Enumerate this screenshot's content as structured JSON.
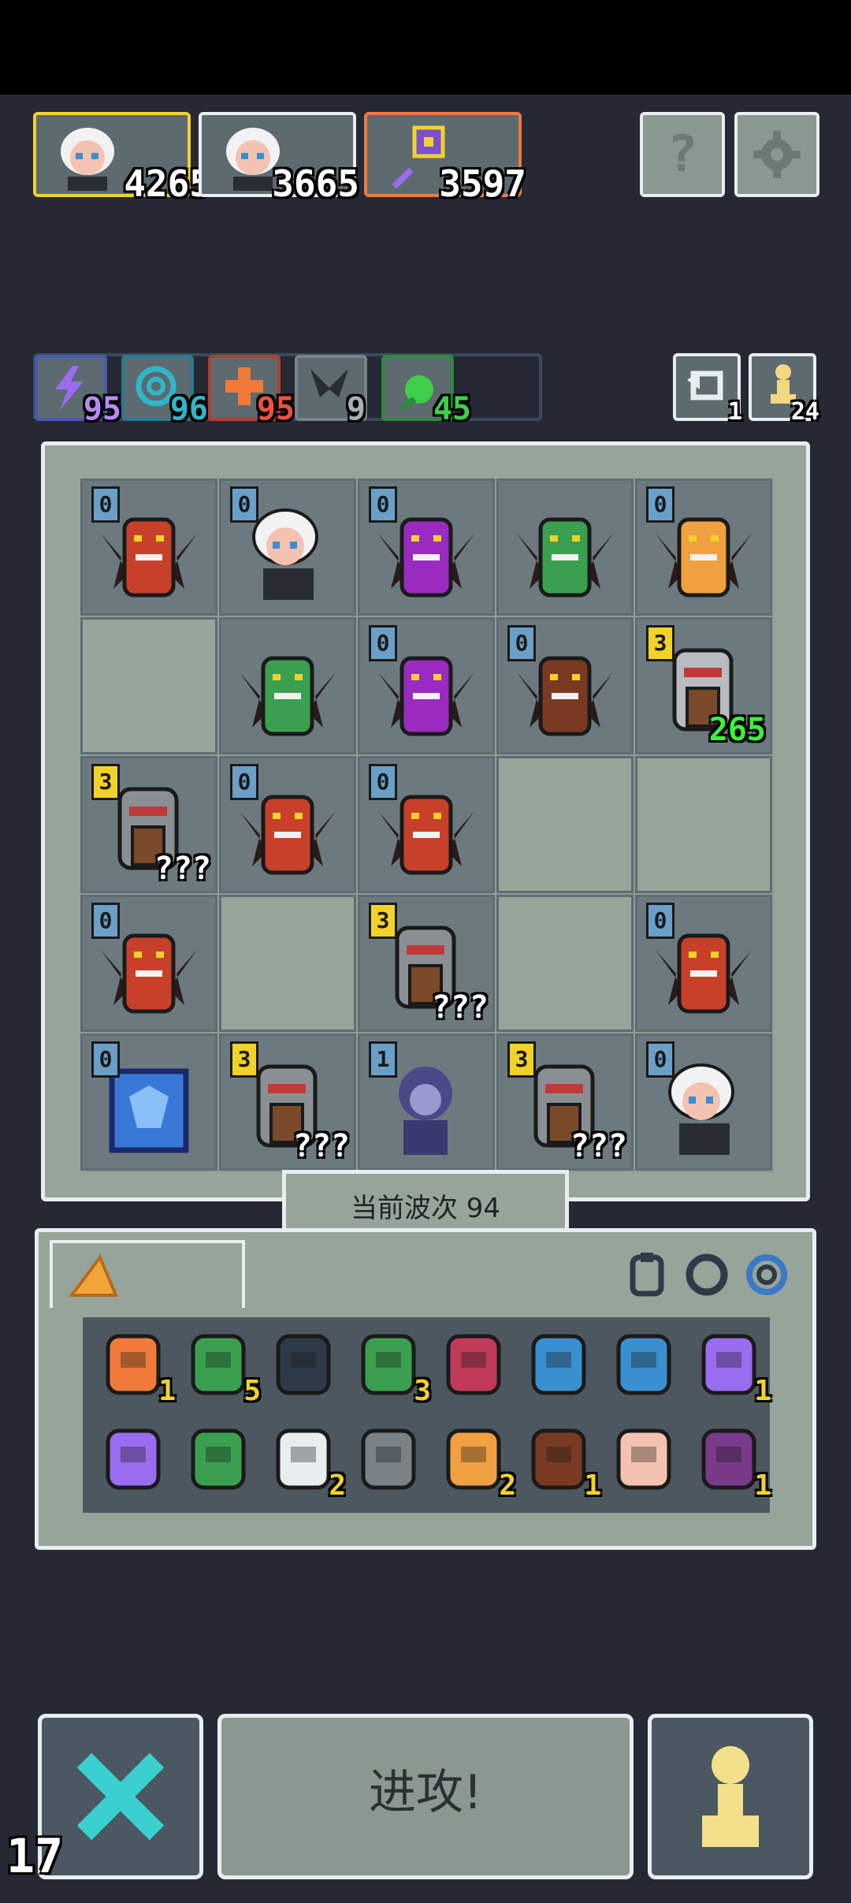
{
  "party": [
    {
      "name": "demon-girl-hero",
      "score": "4265",
      "frame_color": "#f2d22a"
    },
    {
      "name": "demon-girl-hero",
      "score": "3665",
      "frame_color": "#e8eef0"
    },
    {
      "name": "wand-hero",
      "score": "3597",
      "frame_color": "#f07a3a"
    }
  ],
  "top_buttons": {
    "help": "help-icon",
    "settings": "gear-icon"
  },
  "element_bars": [
    {
      "icon": "lightning-icon",
      "value": "95",
      "color": "#9a6cf0"
    },
    {
      "icon": "swirl-icon",
      "value": "96",
      "color": "#2fb7c9"
    },
    {
      "icon": "cross-icon",
      "value": "95",
      "color": "#f05040"
    },
    {
      "icon": "wing-icon",
      "value": "9",
      "color": "#a8b0b4"
    },
    {
      "icon": "leaf-icon",
      "value": "45",
      "color": "#3ecf4a"
    }
  ],
  "counters": {
    "refresh": "1",
    "pawn": "24"
  },
  "board": [
    [
      {
        "lvl": "0",
        "unit": "red-dragon"
      },
      {
        "lvl": "0",
        "unit": "demon-girl"
      },
      {
        "lvl": "0",
        "unit": "purple-dragon"
      },
      {
        "lvl": "",
        "unit": "green-dragon"
      },
      {
        "lvl": "0",
        "unit": "lion-cat"
      }
    ],
    [
      {
        "lvl": "",
        "unit": ""
      },
      {
        "lvl": "",
        "unit": "green-dragon"
      },
      {
        "lvl": "0",
        "unit": "purple-dragon"
      },
      {
        "lvl": "0",
        "unit": "brown-golem"
      },
      {
        "lvl": "3",
        "unit": "knight",
        "value": "265",
        "value_color": "green"
      }
    ],
    [
      {
        "lvl": "3",
        "unit": "shield-knight",
        "value": "???"
      },
      {
        "lvl": "0",
        "unit": "red-dragon"
      },
      {
        "lvl": "0",
        "unit": "red-dragon"
      },
      {
        "lvl": "",
        "unit": ""
      },
      {
        "lvl": "",
        "unit": ""
      }
    ],
    [
      {
        "lvl": "0",
        "unit": "red-dragon"
      },
      {
        "lvl": "",
        "unit": ""
      },
      {
        "lvl": "3",
        "unit": "shield-knight",
        "value": "???"
      },
      {
        "lvl": "",
        "unit": ""
      },
      {
        "lvl": "0",
        "unit": "red-dragon"
      }
    ],
    [
      {
        "lvl": "0",
        "unit": "blue-crystal"
      },
      {
        "lvl": "3",
        "unit": "shield-knight",
        "value": "???"
      },
      {
        "lvl": "1",
        "unit": "medusa"
      },
      {
        "lvl": "3",
        "unit": "shield-knight",
        "value": "???"
      },
      {
        "lvl": "0",
        "unit": "demon-girl"
      }
    ]
  ],
  "wave": {
    "label": "当前波次 94"
  },
  "inventory": {
    "tab_icon": "cheese-icon",
    "filter_icons": [
      "armor-icon",
      "ring-icon",
      "gear-ring-icon"
    ],
    "rows": [
      [
        {
          "icon": "bucket-icon",
          "count": "1"
        },
        {
          "icon": "frog-icon",
          "count": "5"
        },
        {
          "icon": "shield-icon",
          "count": ""
        },
        {
          "icon": "plant-icon",
          "count": "3"
        },
        {
          "icon": "eye-orb-icon",
          "count": ""
        },
        {
          "icon": "blue-fish-icon",
          "count": ""
        },
        {
          "icon": "water-drop-icon",
          "count": ""
        },
        {
          "icon": "potion-jar-icon",
          "count": "1"
        }
      ],
      [
        {
          "icon": "wand-icon",
          "count": ""
        },
        {
          "icon": "chest-mimic-icon",
          "count": ""
        },
        {
          "icon": "claw-icon",
          "count": "2"
        },
        {
          "icon": "shuriken-icon",
          "count": ""
        },
        {
          "icon": "starburst-icon",
          "count": "2"
        },
        {
          "icon": "boot-icon",
          "count": "1"
        },
        {
          "icon": "hand-eye-icon",
          "count": ""
        },
        {
          "icon": "bat-face-icon",
          "count": "1"
        }
      ]
    ]
  },
  "bottom": {
    "attack_label": "进攻!",
    "cancel_icon": "close-icon",
    "pawn_icon": "pawn-icon"
  },
  "fps": "17"
}
